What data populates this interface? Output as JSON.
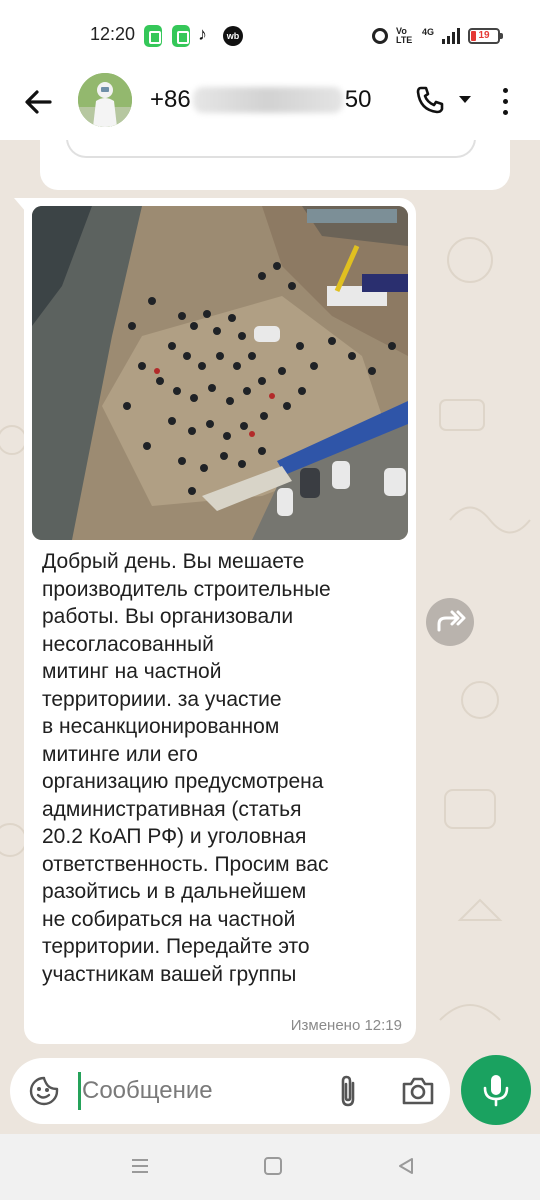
{
  "status_bar": {
    "time": "12:20",
    "app_badge": "wb",
    "network": "4G",
    "volte": "Vo LTE",
    "battery": "19",
    "battery_color": "#e53935"
  },
  "header": {
    "contact_prefix": "+86",
    "contact_suffix": "50",
    "icons": [
      "back-arrow-icon",
      "call-icon",
      "chevron-down-icon",
      "more-vert-icon"
    ]
  },
  "message": {
    "text": "Добрый день. Вы мешаете\nпроизводитель строительные\nработы. Вы организовали\nнесогласованный\nмитинг на частной\nтерриториии. за участие\nв несанкционированном\nмитинге или его\nорганизацию предусмотрена\nадминистративная (статья\n20.2 КоАП РФ) и уголовная\nответственность. Просим вас\nразойтись и в дальнейшем\nне собираться на частной\nтерритории. Передайте это\nучастникам вашей группы",
    "meta": "Изменено 12:19",
    "has_photo": true
  },
  "input": {
    "placeholder": "Сообщение"
  },
  "colors": {
    "accent": "#1aa260",
    "chat_background": "#ece5dd",
    "bubble": "#ffffff"
  }
}
